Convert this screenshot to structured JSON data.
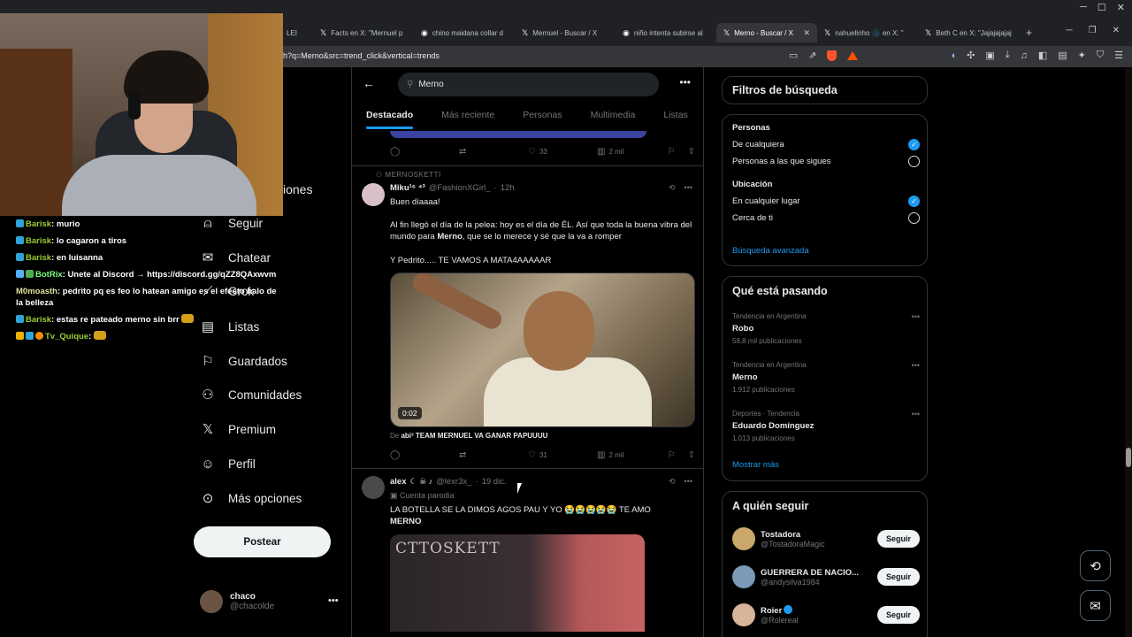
{
  "browser": {
    "tabs": [
      {
        "label": "LEI",
        "icon": "",
        "active": false
      },
      {
        "label": "Facts en X: \"Mernuel p",
        "icon": "X",
        "active": false
      },
      {
        "label": "chino maidana collar d",
        "icon": "G",
        "active": false
      },
      {
        "label": "Mernuel - Buscar / X",
        "icon": "X",
        "active": false
      },
      {
        "label": "niño intenta subirse al",
        "icon": "G",
        "active": false
      },
      {
        "label": "Merno - Buscar / X",
        "icon": "X",
        "active": true
      },
      {
        "label": "nahuelinho 🌑 en X: \"",
        "icon": "X",
        "active": false
      },
      {
        "label": "Beth C en X: \"Jajajajajaj",
        "icon": "X",
        "active": false
      }
    ],
    "url": "h?q=Merno&src=trend_click&vertical=trends"
  },
  "chat": [
    {
      "user": "Barisk",
      "text": "murio",
      "kind": "sub"
    },
    {
      "user": "Barisk",
      "text": "lo cagaron a tiros",
      "kind": "sub"
    },
    {
      "user": "Barisk",
      "text": "en luisanna",
      "kind": "sub"
    },
    {
      "user": "BotRix",
      "text": "Unete al Discord → https://discord.gg/qZZ8QAxwvm",
      "kind": "bot"
    },
    {
      "user": "M0moasth",
      "text": "pedrito pq es feo lo hatean amigo es el efecto halo de la belleza",
      "kind": "plain"
    },
    {
      "user": "Barisk",
      "text": "estas re pateado merno sin brr",
      "kind": "sub"
    },
    {
      "user": "Tv_Quique",
      "text": "",
      "kind": "quique"
    }
  ],
  "nav": {
    "cut_label": "iones",
    "items": [
      {
        "label": "Seguir",
        "icon": "person-add-icon"
      },
      {
        "label": "Chatear",
        "icon": "mail-icon"
      },
      {
        "label": "Grok",
        "icon": "grok-icon"
      },
      {
        "label": "Listas",
        "icon": "list-icon"
      },
      {
        "label": "Guardados",
        "icon": "bookmark-icon"
      },
      {
        "label": "Comunidades",
        "icon": "communities-icon"
      },
      {
        "label": "Premium",
        "icon": "x-logo-icon"
      },
      {
        "label": "Perfil",
        "icon": "profile-icon"
      },
      {
        "label": "Más opciones",
        "icon": "more-circle-icon"
      }
    ],
    "post_label": "Postear",
    "account": {
      "name": "chaco",
      "handle": "@chacolde"
    }
  },
  "search": {
    "query": "Merno",
    "tabs": [
      "Destacado",
      "Más reciente",
      "Personas",
      "Multimedia",
      "Listas"
    ],
    "active_tab": 0
  },
  "tweets": [
    {
      "actions": {
        "replies": "",
        "retweets": "",
        "likes": "33",
        "views": "2 mil"
      }
    },
    {
      "context": "MERNOSKETTI",
      "name": "Miku¹⁶ ⁴³",
      "handle": "@FashionXGirl_",
      "time": "12h",
      "lines": [
        "Buen díaaaa!",
        "Al fin llegó el día de la pelea: hoy es el día de ÉL. Así que toda la buena vibra del mundo para Merno, que se lo merece y sé que la va a romper",
        "Y Pedrito..... TE VAMOS A MATA4AAAAAR"
      ],
      "video_duration": "0:02",
      "video_caption_prefix": "De ",
      "video_caption_user": "abi³ TEAM MERNUEL VA GANAR PAPUUUU",
      "actions": {
        "replies": "",
        "retweets": "",
        "likes": "31",
        "views": "2 mil"
      }
    },
    {
      "name": "alex",
      "handle": "@lexr3x_",
      "time": "19 dic.",
      "label": "Cuenta parodia",
      "text_line1": "LA BOTELLA SE LA DIMOS AGOS PAU Y YO 😭😭😭😭😭 TE AMO",
      "text_line2": "MERNO",
      "image_text": "CTTOSKETT"
    }
  ],
  "filters": {
    "title": "Filtros de búsqueda",
    "people_title": "Personas",
    "people_options": [
      "De cualquiera",
      "Personas a las que sigues"
    ],
    "people_selected": 0,
    "location_title": "Ubicación",
    "location_options": [
      "En cualquier lugar",
      "Cerca de ti"
    ],
    "location_selected": 0,
    "advanced": "Búsqueda avanzada"
  },
  "trends": {
    "title": "Qué está pasando",
    "items": [
      {
        "category": "Tendencia en Argentina",
        "name": "Robo",
        "count": "58,8 mil publicaciones"
      },
      {
        "category": "Tendencia en Argentina",
        "name": "Merno",
        "count": "1.912 publicaciones"
      },
      {
        "category": "Deportes · Tendencia",
        "name": "Eduardo Domínguez",
        "count": "1.013 publicaciones"
      }
    ],
    "show_more": "Mostrar más"
  },
  "who_to_follow": {
    "title": "A quién seguir",
    "follow_label": "Seguir",
    "items": [
      {
        "name": "Tostadora",
        "handle": "@TostadoraMagic",
        "verified": false
      },
      {
        "name": "GUERRERA DE NACIO...",
        "handle": "@andysilva1984",
        "verified": false
      },
      {
        "name": "Roier",
        "handle": "@Rolereal",
        "verified": true
      }
    ]
  },
  "colors": {
    "accent": "#1d9bf0",
    "bg": "#000000",
    "border": "#2f3336",
    "muted": "#71767b"
  }
}
